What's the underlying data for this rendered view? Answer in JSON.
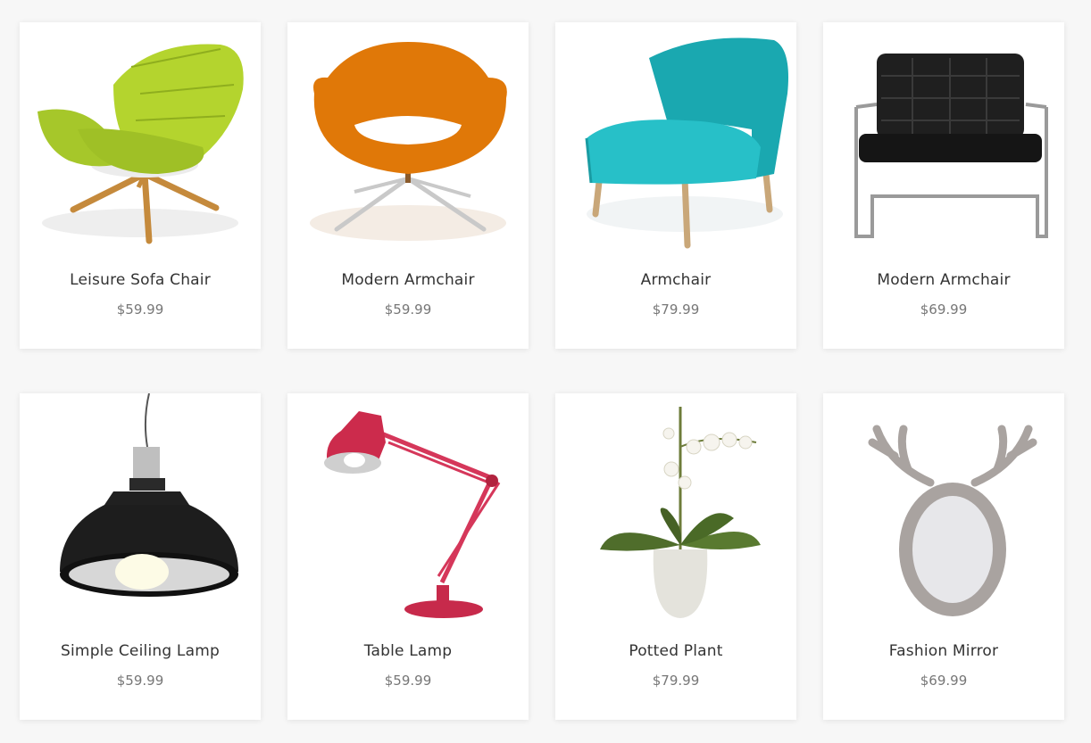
{
  "products": [
    {
      "name": "Leisure Sofa Chair",
      "price": "$59.99",
      "icon": "leisure-sofa-chair-image",
      "color": "#a9c92b"
    },
    {
      "name": "Modern Armchair",
      "price": "$59.99",
      "icon": "orange-armchair-image",
      "color": "#e07808"
    },
    {
      "name": "Armchair",
      "price": "$79.99",
      "icon": "teal-armchair-image",
      "color": "#22b5bd"
    },
    {
      "name": "Modern Armchair",
      "price": "$69.99",
      "icon": "black-leather-armchair-image",
      "color": "#1c1c1c"
    },
    {
      "name": "Simple Ceiling Lamp",
      "price": "$59.99",
      "icon": "ceiling-lamp-image",
      "color": "#202020"
    },
    {
      "name": "Table Lamp",
      "price": "$59.99",
      "icon": "table-lamp-image",
      "color": "#cf2b4d"
    },
    {
      "name": "Potted Plant",
      "price": "$79.99",
      "icon": "potted-plant-image",
      "color": "#4e6b2a"
    },
    {
      "name": "Fashion Mirror",
      "price": "$69.99",
      "icon": "fashion-mirror-image",
      "color": "#a9a3a0"
    }
  ]
}
